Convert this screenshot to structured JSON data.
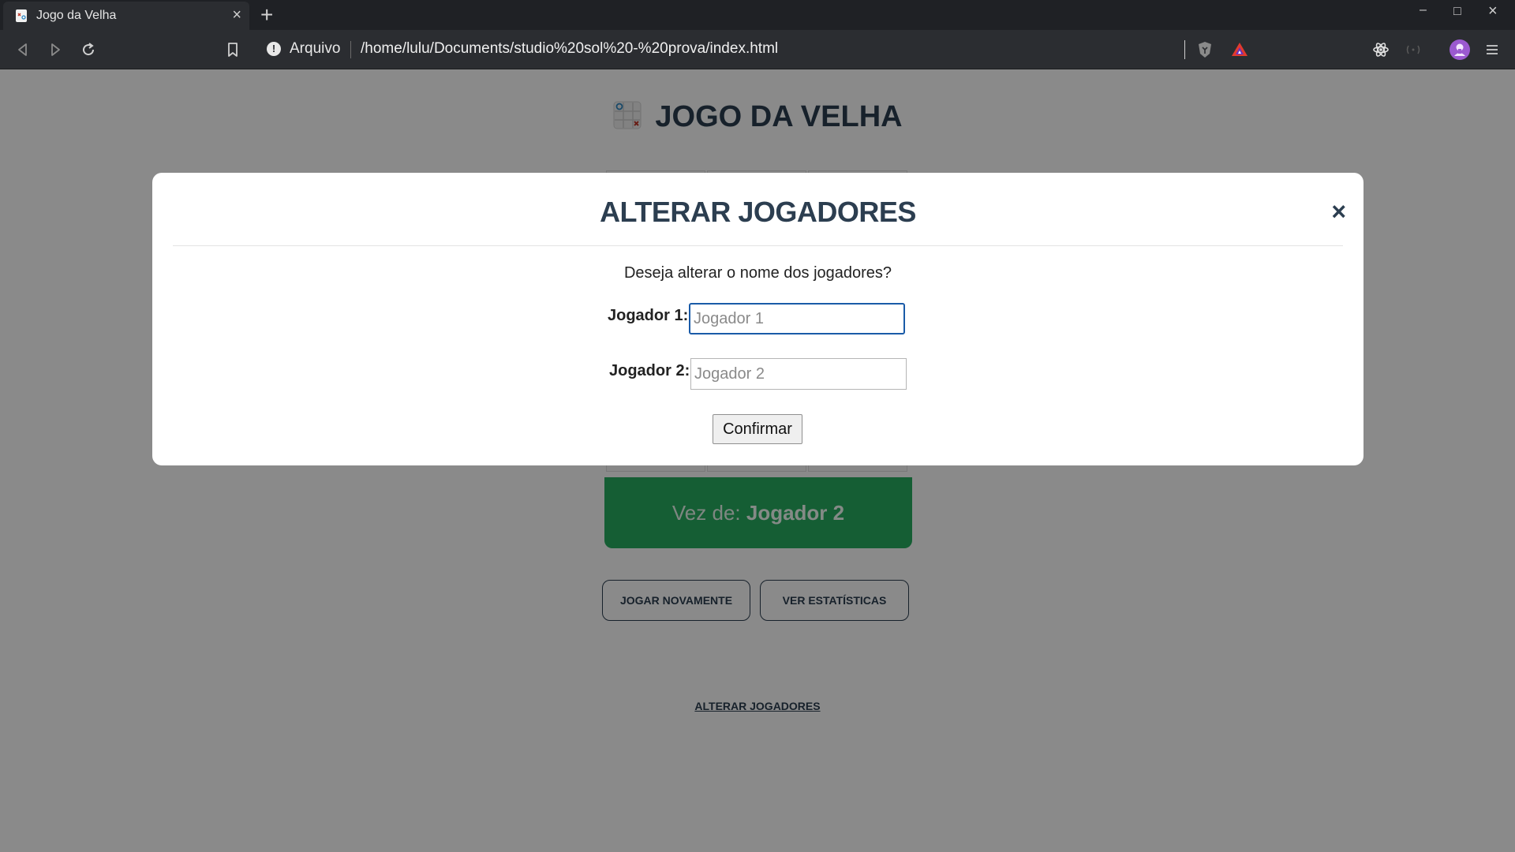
{
  "browser": {
    "tab_title": "Jogo da Velha",
    "tab_close": "×",
    "new_tab": "+",
    "site_label": "Arquivo",
    "site_info_glyph": "!",
    "url": "/home/lulu/Documents/studio%20sol%20-%20prova/index.html",
    "window_controls": {
      "minimize": "–",
      "maximize": "□",
      "close": "×"
    }
  },
  "game": {
    "title": "JOGO DA VELHA",
    "turn_prefix": "Vez de:",
    "turn_player": "Jogador 2",
    "play_again": "JOGAR NOVAMENTE",
    "view_stats": "VER ESTATÍSTICAS",
    "change_players_link": "ALTERAR JOGADORES"
  },
  "modal": {
    "title": "ALTERAR JOGADORES",
    "close": "×",
    "question": "Deseja alterar o nome dos jogadores?",
    "player1_label": "Jogador 1:",
    "player1_value": "",
    "player1_placeholder": "Jogador 1",
    "player2_label": "Jogador 2:",
    "player2_value": "",
    "player2_placeholder": "Jogador 2",
    "confirm": "Confirmar"
  },
  "colors": {
    "heading": "#2c3e50",
    "turn_banner": "#27ae60",
    "overlay": "rgba(0,0,0,0.46)",
    "browser_dark": "#2b2d31"
  },
  "icons": [
    "file-icon",
    "back-icon",
    "forward-icon",
    "reload-icon",
    "bookmark-icon",
    "site-info-icon",
    "brave-shield-icon",
    "brave-rewards-icon",
    "extensions-icon",
    "wallet-icon",
    "profile-icon",
    "menu-icon",
    "tictactoe-logo-icon"
  ]
}
